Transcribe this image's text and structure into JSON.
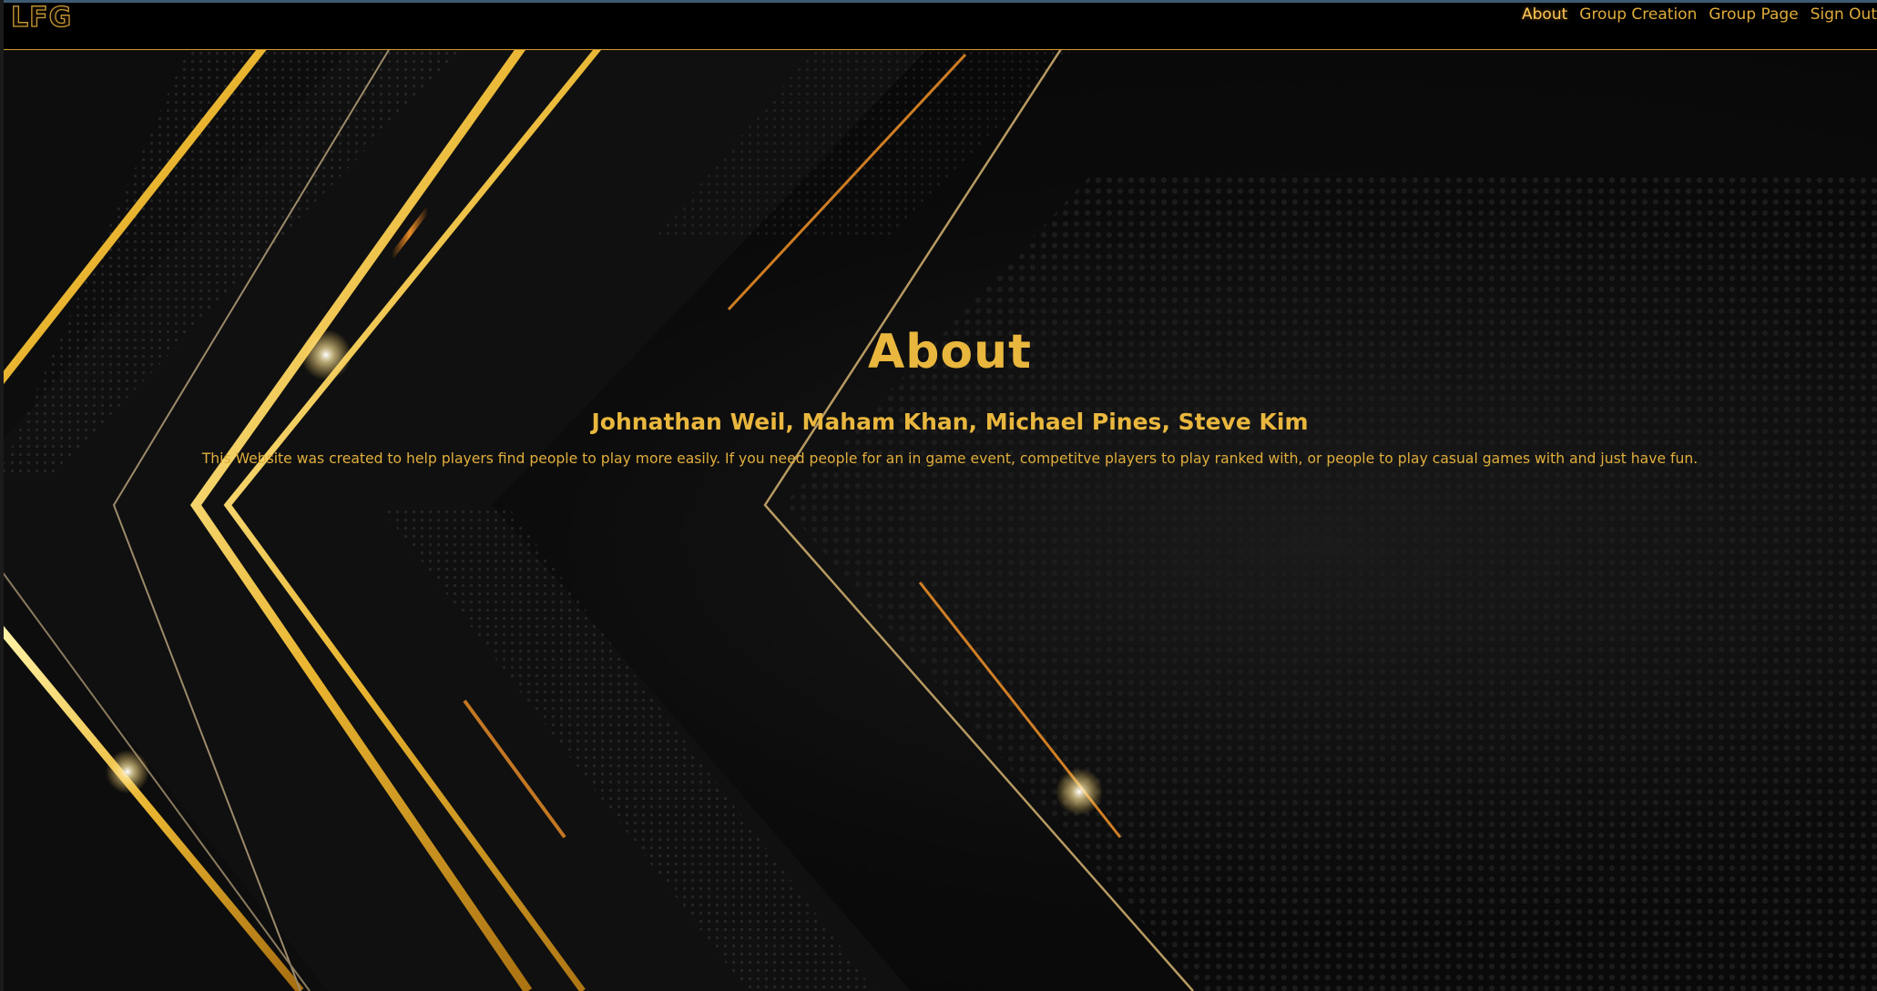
{
  "logo": {
    "text": "LFG"
  },
  "nav": {
    "items": [
      {
        "label": "About",
        "active": true
      },
      {
        "label": "Group Creation",
        "active": false
      },
      {
        "label": "Group Page",
        "active": false
      },
      {
        "label": "Sign Out",
        "active": false
      }
    ]
  },
  "main": {
    "title": "About",
    "authors": "Johnathan Weil, Maham Khan, Michael Pines, Steve Kim",
    "description": "This Website was created to help players find people to play more easily. If you need people for an in game event, competitve players to play ranked with, or people to play casual games with and just have fun."
  },
  "colors": {
    "accent": "#e9b73e",
    "background": "#050505",
    "nav_border": "#d39a2a"
  }
}
